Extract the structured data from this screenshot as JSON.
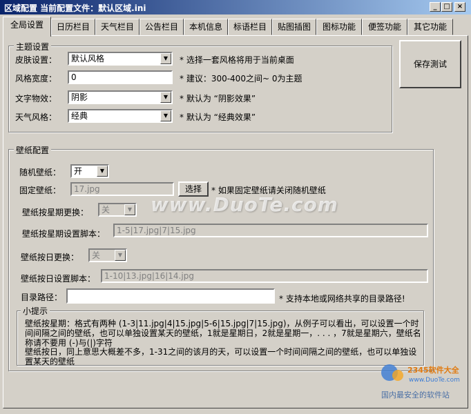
{
  "window": {
    "title": "区域配置 当前配置文件：默认区域.ini",
    "controls": [
      "_",
      "□",
      "×"
    ]
  },
  "tabs": [
    {
      "label": "全局设置",
      "active": true
    },
    {
      "label": "日历栏目"
    },
    {
      "label": "天气栏目"
    },
    {
      "label": "公告栏目"
    },
    {
      "label": "本机信息"
    },
    {
      "label": "标语栏目"
    },
    {
      "label": "贴图插图"
    },
    {
      "label": "图标功能"
    },
    {
      "label": "便签功能"
    },
    {
      "label": "其它功能"
    }
  ],
  "theme": {
    "legend": "主题设置",
    "skin_label": "皮肤设置：",
    "skin_value": "默认风格",
    "skin_note": "* 选择一套风格将用于当前桌面",
    "width_label": "风格宽度：",
    "width_value": "0",
    "width_note": "* 建议：300-400之间~ 0为主题",
    "effect_label": "文字物效：",
    "effect_value": "阴影",
    "effect_note": "* 默认为 “阴影效果”",
    "weather_label": "天气风格：",
    "weather_value": "经典",
    "weather_note": "* 默认为 “经典效果”"
  },
  "save_button": "保存測试",
  "wallpaper": {
    "legend": "壁纸配置",
    "random_label": "随机壁纸：",
    "random_value": "开",
    "fixed_label": "固定壁纸：",
    "fixed_value": "17.jpg",
    "browse_button": "选择",
    "fixed_note": "* 如果固定壁纸请关闭随机壁纸",
    "weekly_label": "壁纸按星期更换：",
    "weekly_value": "关",
    "weekly_script_label": "壁纸按星期设置脚本：",
    "weekly_script_value": "1-5|17.jpg|7|15.jpg",
    "daily_label": "壁纸按日更换：",
    "daily_value": "关",
    "daily_script_label": "壁纸按日设置脚本：",
    "daily_script_value": "1-10|13.jpg|16|14.jpg",
    "dir_label": "目录路径：",
    "dir_value": "",
    "dir_note": "* 支持本地或网络共享的目录路径!"
  },
  "hint": {
    "legend": "小提示",
    "line1": "壁纸按星期：格式有两种 (1-3|11.jpg|4|15.jpg|5-6|15.jpg|7|15.jpg)，从例子可以看出，可以设置一个时间间隔之间的壁纸，也可以单独设置某天的壁纸，1就是星期日，2就是星期一，. . . ，7就是星期六，壁纸名称请不要用 (-)与(|)字符",
    "line2": "壁纸按日，同上意思大概差不多，1-31之间的该月的天，可以设置一个时间间隔之间的壁纸，也可以单独设置某天的壁纸"
  },
  "watermark": "www.DuoTe.com",
  "logo": {
    "brand": "2345软件大全",
    "url": "www.DuoTe.com",
    "slogan": "国内最安全的软件站"
  },
  "colors": {
    "face": "#d4d0c8",
    "title_start": "#0a246a",
    "title_end": "#a6caf0"
  }
}
